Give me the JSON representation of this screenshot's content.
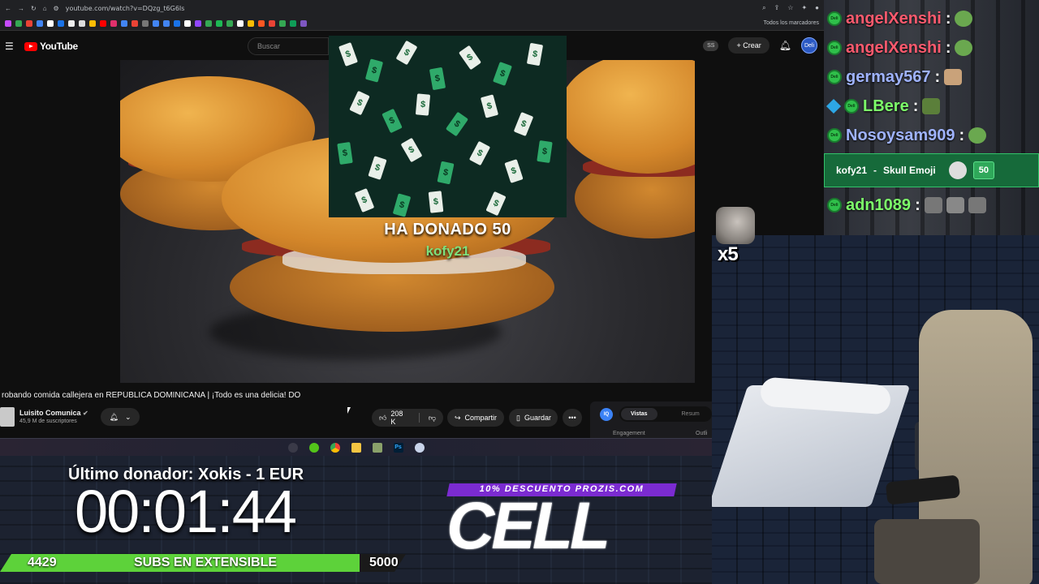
{
  "browser": {
    "url": "youtube.com/watch?v=DQzg_t6G6Is",
    "bookmarks_folder": "Todos los marcadores"
  },
  "youtube": {
    "logo_text": "YouTube",
    "search_placeholder": "Buscar",
    "profile_badge": "SS",
    "create_button": "Crear",
    "avatar_text": "Deli"
  },
  "video": {
    "overlay_title": "HA DONADO 50",
    "overlay_user": "kofy21",
    "title": "robando comida callejera en REPÚBLICA DOMINICANA | ¡Todo es una delicia! DO",
    "bill_symbol": "$"
  },
  "channel": {
    "name": "Luisito Comunica",
    "subscribers": "45,9 M de suscriptores"
  },
  "actions": {
    "likes": "208 K",
    "share": "Compartir",
    "save": "Guardar",
    "more": "•••"
  },
  "extension": {
    "logo": "IQ",
    "tab_active": "Vistas",
    "tab_other": "Resum",
    "label_left": "Engagement",
    "label_right": "Outli"
  },
  "taskbar": {
    "ps_label": "Ps"
  },
  "overlay": {
    "last_donor": "Último donador: Xokis - 1 EUR",
    "timer": "00:01:44",
    "subs_current": "4429",
    "subs_label": "SUBS EN EXTENSIBLE",
    "subs_goal": "5000",
    "subs_progress": 0.886,
    "promo": "10% DESCUENTO PROZIS.COM",
    "brand": "CELL",
    "multiplier": "x5"
  },
  "chat": {
    "messages": [
      {
        "user": "angelXenshi",
        "color": "#ff5a6e",
        "badge": "Deli"
      },
      {
        "user": "angelXenshi",
        "color": "#ff5a6e",
        "badge": "Deli"
      },
      {
        "user": "germay567",
        "color": "#9fb3ff",
        "badge": "Deli"
      },
      {
        "user": "LBere",
        "color": "#7dff6a",
        "badge": "Deli"
      },
      {
        "user": "Nosoysam909",
        "color": "#9fb3ff",
        "badge": "Deli"
      },
      {
        "user": "adn1089",
        "color": "#7dff6a",
        "badge": "Deli"
      }
    ],
    "colon": ":",
    "donation": {
      "user": "kofy21",
      "separator": "-",
      "reward": "Skull Emoji",
      "amount": "50"
    }
  }
}
